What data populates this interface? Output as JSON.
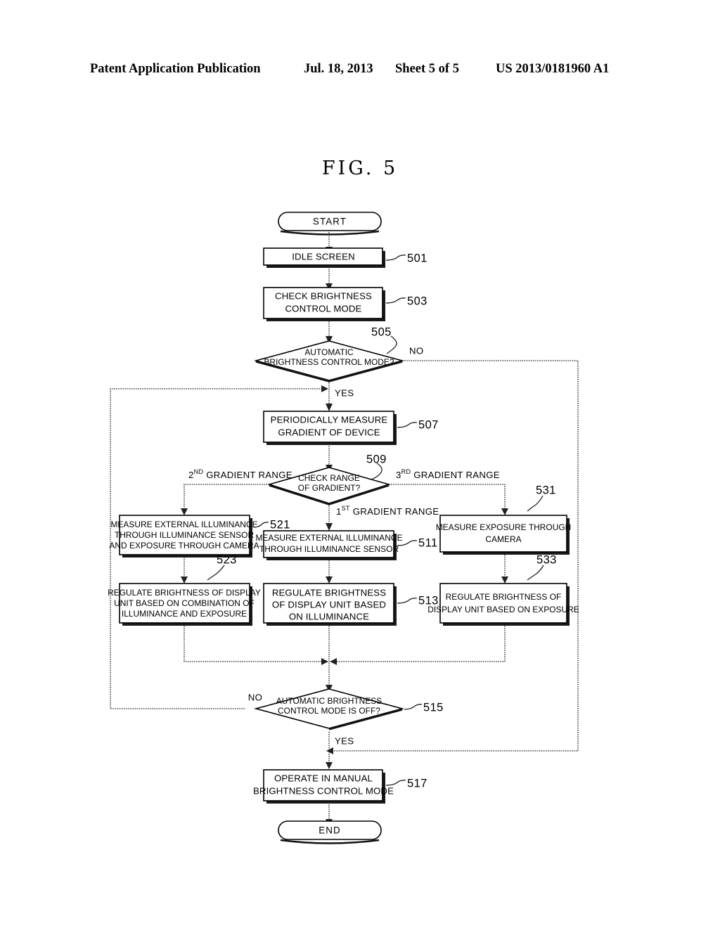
{
  "page_header": {
    "publication": "Patent Application Publication",
    "date": "Jul. 18, 2013",
    "sheet": "Sheet 5 of 5",
    "patent_number": "US 2013/0181960 A1"
  },
  "figure": {
    "title": "FIG. 5"
  },
  "nodes": {
    "start": {
      "label": "START",
      "ref": ""
    },
    "n501": {
      "line1": "IDLE SCREEN",
      "ref": "501"
    },
    "n503": {
      "line1": "CHECK BRIGHTNESS",
      "line2": "CONTROL MODE",
      "ref": "503"
    },
    "n505": {
      "line1": "AUTOMATIC",
      "line2": "BRIGHTNESS CONTROL MODE?",
      "ref": "505"
    },
    "n507": {
      "line1": "PERIODICALLY MEASURE",
      "line2": "GRADIENT OF DEVICE",
      "ref": "507"
    },
    "n509": {
      "line1": "CHECK RANGE",
      "line2": "OF GRADIENT?",
      "ref": "509"
    },
    "n521": {
      "line1": "MEASURE EXTERNAL ILLUMINANCE",
      "line2": "THROUGH ILLUMINANCE SENSOR",
      "line3": "AND EXPOSURE THROUGH CAMERA",
      "ref": "521"
    },
    "n511": {
      "line1": "MEASURE EXTERNAL ILLUMINANCE",
      "line2": "THROUGH ILLUMINANCE SENSOR",
      "ref": "511"
    },
    "n531": {
      "line1": "MEASURE EXPOSURE THROUGH",
      "line2": "CAMERA",
      "ref": "531"
    },
    "n523": {
      "line1": "REGULATE BRIGHTNESS OF DISPLAY",
      "line2": "UNIT BASED ON COMBINATION OF",
      "line3": "ILLUMINANCE AND EXPOSURE",
      "ref": "523"
    },
    "n513": {
      "line1": "REGULATE BRIGHTNESS",
      "line2": "OF DISPLAY UNIT BASED",
      "line3": "ON ILLUMINANCE",
      "ref": "513"
    },
    "n533": {
      "line1": "REGULATE BRIGHTNESS OF",
      "line2": "DISPLAY UNIT BASED ON EXPOSURE",
      "ref": "533"
    },
    "n515": {
      "line1": "AUTOMATIC BRIGHTNESS",
      "line2": "CONTROL MODE IS OFF?",
      "ref": "515"
    },
    "n517": {
      "line1": "OPERATE IN MANUAL",
      "line2": "BRIGHTNESS CONTROL MODE",
      "ref": "517"
    },
    "end": {
      "label": "END",
      "ref": ""
    }
  },
  "edge_labels": {
    "no_505": "NO",
    "yes_505": "YES",
    "range_2nd_num": "2",
    "range_2nd_sup": "ND",
    "range_2nd_text": " GRADIENT RANGE",
    "range_3rd_num": "3",
    "range_3rd_sup": "RD",
    "range_3rd_text": " GRADIENT RANGE",
    "range_1st_num": "1",
    "range_1st_sup": "ST",
    "range_1st_text": " GRADIENT RANGE",
    "no_515": "NO",
    "yes_515": "YES"
  },
  "colors": {
    "ink": "#000000",
    "line": "#222222",
    "paper": "#ffffff"
  }
}
